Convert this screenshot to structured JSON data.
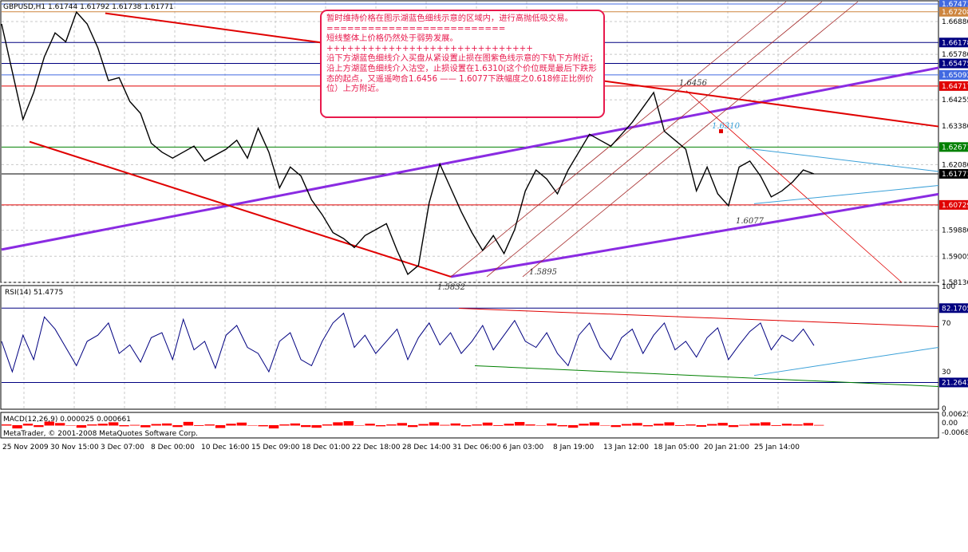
{
  "header": {
    "main_title": "GBPUSD,H1  1.61744 1.61792 1.61738 1.61771",
    "rsi_title": "RSI(14) 51.4775",
    "macd_title": "MACD(12,26,9) 0.000025 0.000661",
    "copyright": "MetaTrader, © 2001-2008 MetaQuotes Software Corp."
  },
  "note": {
    "lines": [
      "暂时维持价格在图示湖蓝色细线示意的区域内，进行高抛低吸交易。",
      "==========================",
      "短线整体上价格仍然处于弱势发展。",
      "++++++++++++++++++++++++++++++",
      "沿下方湖蓝色细线介入买盘从紧设置止损在图紫色线示意的下轨下方附近；",
      "沿上方湖蓝色细线介入沽空，止损设置在1.6310(这个价位既是最后下跌形态的起点，又遥遥吻合1.6456 —— 1.6077下跌幅度之0.618修正比例价位）上方附近。"
    ]
  },
  "annotations": {
    "a1": "1.6456",
    "a2": "1.6310",
    "a3": "1.6077",
    "a4": "1.5895",
    "a5": "1.5832"
  },
  "price_scale": {
    "ticks": [
      "1.66880",
      "1.65780",
      "1.64255",
      "1.63380",
      "1.62080",
      "1.60705",
      "1.59880",
      "1.59005",
      "1.58130"
    ],
    "levels": [
      {
        "label": "1.67471",
        "color": "#4169e1"
      },
      {
        "label": "1.67208",
        "color": "#cd853f"
      },
      {
        "label": "1.66178",
        "color": "#000080"
      },
      {
        "label": "1.65475",
        "color": "#000080"
      },
      {
        "label": "1.65092",
        "color": "#4169e1"
      },
      {
        "label": "1.64717",
        "color": "#e00000"
      },
      {
        "label": "1.62671",
        "color": "#008000"
      },
      {
        "label": "1.61771",
        "color": "#000000"
      },
      {
        "label": "1.60729",
        "color": "#e00000"
      }
    ]
  },
  "rsi_scale": {
    "ticks": [
      "100",
      "70",
      "30",
      "0"
    ],
    "levels": [
      {
        "label": "82.1705",
        "color": "#000080"
      },
      {
        "label": "21.2643",
        "color": "#000080"
      }
    ]
  },
  "macd_scale": {
    "ticks": [
      "0.00625",
      "0.00",
      "-0.00685"
    ]
  },
  "chart_data": {
    "type": "line",
    "symbol": "GBPUSD",
    "timeframe": "H1",
    "ohlc_current": {
      "open": 1.61744,
      "high": 1.61792,
      "low": 1.61738,
      "close": 1.61771
    },
    "time_labels": [
      "25 Nov 2009",
      "30 Nov 15:00",
      "3 Dec 07:00",
      "8 Dec 00:00",
      "10 Dec 16:00",
      "15 Dec 09:00",
      "18 Dec 01:00",
      "22 Dec 18:00",
      "28 Dec 14:00",
      "31 Dec 06:00",
      "6 Jan 03:00",
      "8 Jan 19:00",
      "13 Jan 12:00",
      "18 Jan 05:00",
      "20 Jan 21:00",
      "25 Jan 14:00"
    ],
    "ylim": [
      1.5813,
      1.6755
    ],
    "price_path": [
      1.668,
      1.652,
      1.636,
      1.645,
      1.657,
      1.665,
      1.662,
      1.672,
      1.668,
      1.66,
      1.649,
      1.65,
      1.642,
      1.638,
      1.628,
      1.625,
      1.623,
      1.625,
      1.627,
      1.622,
      1.624,
      1.626,
      1.629,
      1.623,
      1.633,
      1.625,
      1.613,
      1.62,
      1.617,
      1.609,
      1.604,
      1.598,
      1.596,
      1.593,
      1.597,
      1.599,
      1.601,
      1.592,
      1.584,
      1.587,
      1.608,
      1.621,
      1.613,
      1.605,
      1.598,
      1.592,
      1.597,
      1.591,
      1.599,
      1.612,
      1.619,
      1.616,
      1.611,
      1.619,
      1.625,
      1.631,
      1.629,
      1.627,
      1.631,
      1.635,
      1.64,
      1.645,
      1.632,
      1.629,
      1.626,
      1.612,
      1.62,
      1.611,
      1.607,
      1.62,
      1.622,
      1.617,
      1.61,
      1.612,
      1.615,
      1.619,
      1.6177
    ],
    "rsi_path": [
      55,
      30,
      60,
      40,
      75,
      65,
      50,
      35,
      55,
      60,
      70,
      45,
      52,
      38,
      58,
      62,
      40,
      73,
      48,
      55,
      33,
      60,
      68,
      50,
      45,
      30,
      55,
      62,
      40,
      35,
      55,
      70,
      78,
      50,
      60,
      45,
      55,
      65,
      40,
      58,
      70,
      52,
      62,
      45,
      55,
      68,
      48,
      60,
      72,
      55,
      50,
      62,
      45,
      35,
      60,
      70,
      50,
      40,
      58,
      65,
      45,
      60,
      70,
      48,
      55,
      42,
      58,
      66,
      40,
      52,
      63,
      70,
      48,
      60,
      55,
      65,
      51.4775
    ],
    "macd": {
      "main": 2.5e-05,
      "signal": 0.000661,
      "params": [
        12,
        26,
        9
      ]
    },
    "rsi": {
      "period": 14,
      "value": 51.4775,
      "levels": [
        82.1705,
        21.2643
      ]
    },
    "annotated_prices": [
      1.6456,
      1.631,
      1.6077,
      1.5895,
      1.5832
    ],
    "colors": {
      "price": "#000000",
      "up_channel": "#8a2be2",
      "resistance": "#e00000",
      "triangle": "#3aa0d8",
      "rsi_line": "#000080",
      "macd_hist": "#ff0000"
    }
  }
}
